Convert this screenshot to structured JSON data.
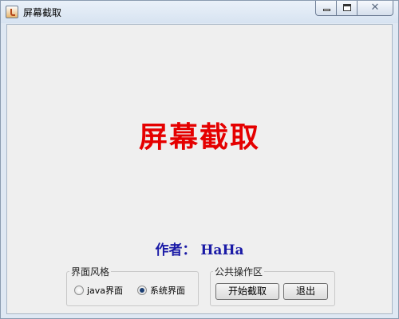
{
  "window": {
    "title": "屏幕截取",
    "controls": {
      "close_glyph": "✕"
    }
  },
  "main": {
    "title": "屏幕截取",
    "title_color": "#e50000",
    "author": "作者：  HaHa",
    "author_color": "#1a1aa6"
  },
  "style_group": {
    "legend": "界面风格",
    "options": [
      {
        "label": "java界面",
        "checked": false
      },
      {
        "label": "系统界面",
        "checked": true
      }
    ]
  },
  "ops_group": {
    "legend": "公共操作区",
    "buttons": [
      {
        "label": "开始截取"
      },
      {
        "label": "退出"
      }
    ]
  },
  "icons": {
    "app": "java-app-icon",
    "minimize": "minimize-icon",
    "maximize": "maximize-icon",
    "close": "close-icon"
  }
}
